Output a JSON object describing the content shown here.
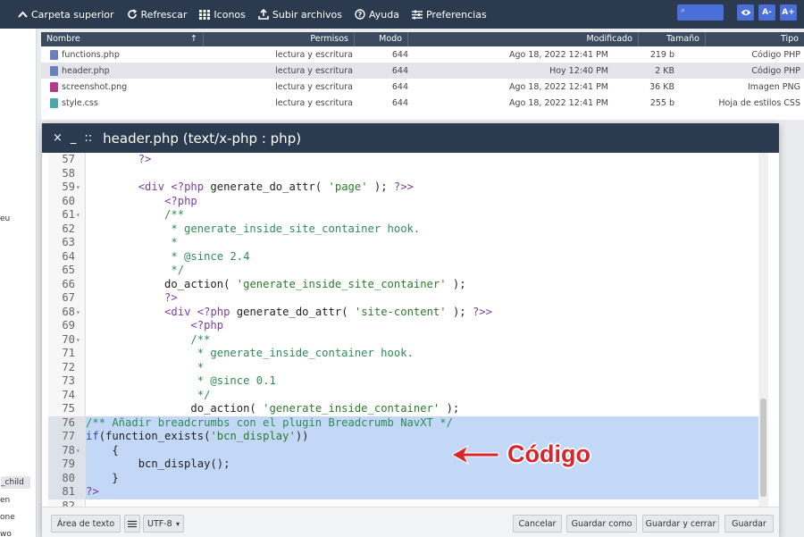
{
  "toolbar": {
    "items": [
      {
        "label": "Carpeta superior",
        "icon": "chevron-up-icon"
      },
      {
        "label": "Refrescar",
        "icon": "refresh-icon"
      },
      {
        "label": "Iconos",
        "icon": "grid-icon"
      },
      {
        "label": "Subir archivos",
        "icon": "upload-icon"
      },
      {
        "label": "Ayuda",
        "icon": "help-icon"
      },
      {
        "label": "Preferencias",
        "icon": "sliders-icon"
      }
    ],
    "search_icon": "search-icon",
    "view_icon": "eye-icon",
    "font_decrease": "A-",
    "font_increase": "A+"
  },
  "sidebar": {
    "fragments": [
      "eu",
      "_child",
      "en",
      "one",
      "wo"
    ]
  },
  "filelist": {
    "columns": [
      "Nombre",
      "Permisos",
      "Modo",
      "Modificado",
      "Tamaño",
      "Tipo"
    ],
    "sort_indicator": "↑",
    "rows": [
      {
        "name": "functions.php",
        "perm": "lectura y escritura",
        "mode": "644",
        "modified": "Ago 18, 2022 12:41 PM",
        "size": "219 b",
        "type": "Código PHP",
        "icon": "php"
      },
      {
        "name": "header.php",
        "perm": "lectura y escritura",
        "mode": "644",
        "modified": "Hoy 12:40 PM",
        "size": "2 KB",
        "type": "Código PHP",
        "icon": "php"
      },
      {
        "name": "screenshot.png",
        "perm": "lectura y escritura",
        "mode": "644",
        "modified": "Ago 18, 2022 12:41 PM",
        "size": "36 KB",
        "type": "Imagen PNG",
        "icon": "png"
      },
      {
        "name": "style.css",
        "perm": "lectura y escritura",
        "mode": "644",
        "modified": "Ago 18, 2022 12:41 PM",
        "size": "255 b",
        "type": "Hoja de estilos CSS",
        "icon": "css"
      }
    ]
  },
  "dialog": {
    "close": "×",
    "minimize": "_",
    "drag": "::",
    "title": "header.php (text/x-php : php)"
  },
  "editor": {
    "lines": [
      {
        "n": "57",
        "fold": false,
        "code": "        ?>"
      },
      {
        "n": "58",
        "fold": false,
        "code": ""
      },
      {
        "n": "59",
        "fold": true,
        "code": "        <div <?php generate_do_attr( 'page' ); ?>>"
      },
      {
        "n": "60",
        "fold": false,
        "code": "            <?php"
      },
      {
        "n": "61",
        "fold": true,
        "code": "            /**"
      },
      {
        "n": "62",
        "fold": false,
        "code": "             * generate_inside_site_container hook."
      },
      {
        "n": "63",
        "fold": false,
        "code": "             *"
      },
      {
        "n": "64",
        "fold": false,
        "code": "             * @since 2.4"
      },
      {
        "n": "65",
        "fold": false,
        "code": "             */"
      },
      {
        "n": "66",
        "fold": false,
        "code": "            do_action( 'generate_inside_site_container' );"
      },
      {
        "n": "67",
        "fold": false,
        "code": "            ?>"
      },
      {
        "n": "68",
        "fold": true,
        "code": "            <div <?php generate_do_attr( 'site-content' ); ?>>"
      },
      {
        "n": "69",
        "fold": false,
        "code": "                <?php"
      },
      {
        "n": "70",
        "fold": true,
        "code": "                /**"
      },
      {
        "n": "71",
        "fold": false,
        "code": "                 * generate_inside_container hook."
      },
      {
        "n": "72",
        "fold": false,
        "code": "                 *"
      },
      {
        "n": "73",
        "fold": false,
        "code": "                 * @since 0.1"
      },
      {
        "n": "74",
        "fold": false,
        "code": "                 */"
      },
      {
        "n": "75",
        "fold": false,
        "code": "                do_action( 'generate_inside_container' );"
      },
      {
        "n": "76",
        "fold": false,
        "code": "/** Añadir breadcrumbs con el plugin Breadcrumb NavXT */"
      },
      {
        "n": "77",
        "fold": false,
        "code": "if(function_exists('bcn_display'))"
      },
      {
        "n": "78",
        "fold": true,
        "code": "    {"
      },
      {
        "n": "79",
        "fold": false,
        "code": "        bcn_display();"
      },
      {
        "n": "80",
        "fold": false,
        "code": "    }"
      },
      {
        "n": "81",
        "fold": false,
        "code": "?>"
      },
      {
        "n": "82",
        "fold": false,
        "code": ""
      }
    ],
    "selected_from": "76",
    "selected_to": "81"
  },
  "annotation": {
    "label": "Código",
    "color": "#d9252a"
  },
  "footer": {
    "textarea_button": "Área de texto",
    "settings_icon": "settings-icon",
    "encoding": "UTF-8",
    "cancel": "Cancelar",
    "save_as": "Guardar como",
    "save_close": "Guardar y cerrar",
    "save": "Guardar"
  }
}
